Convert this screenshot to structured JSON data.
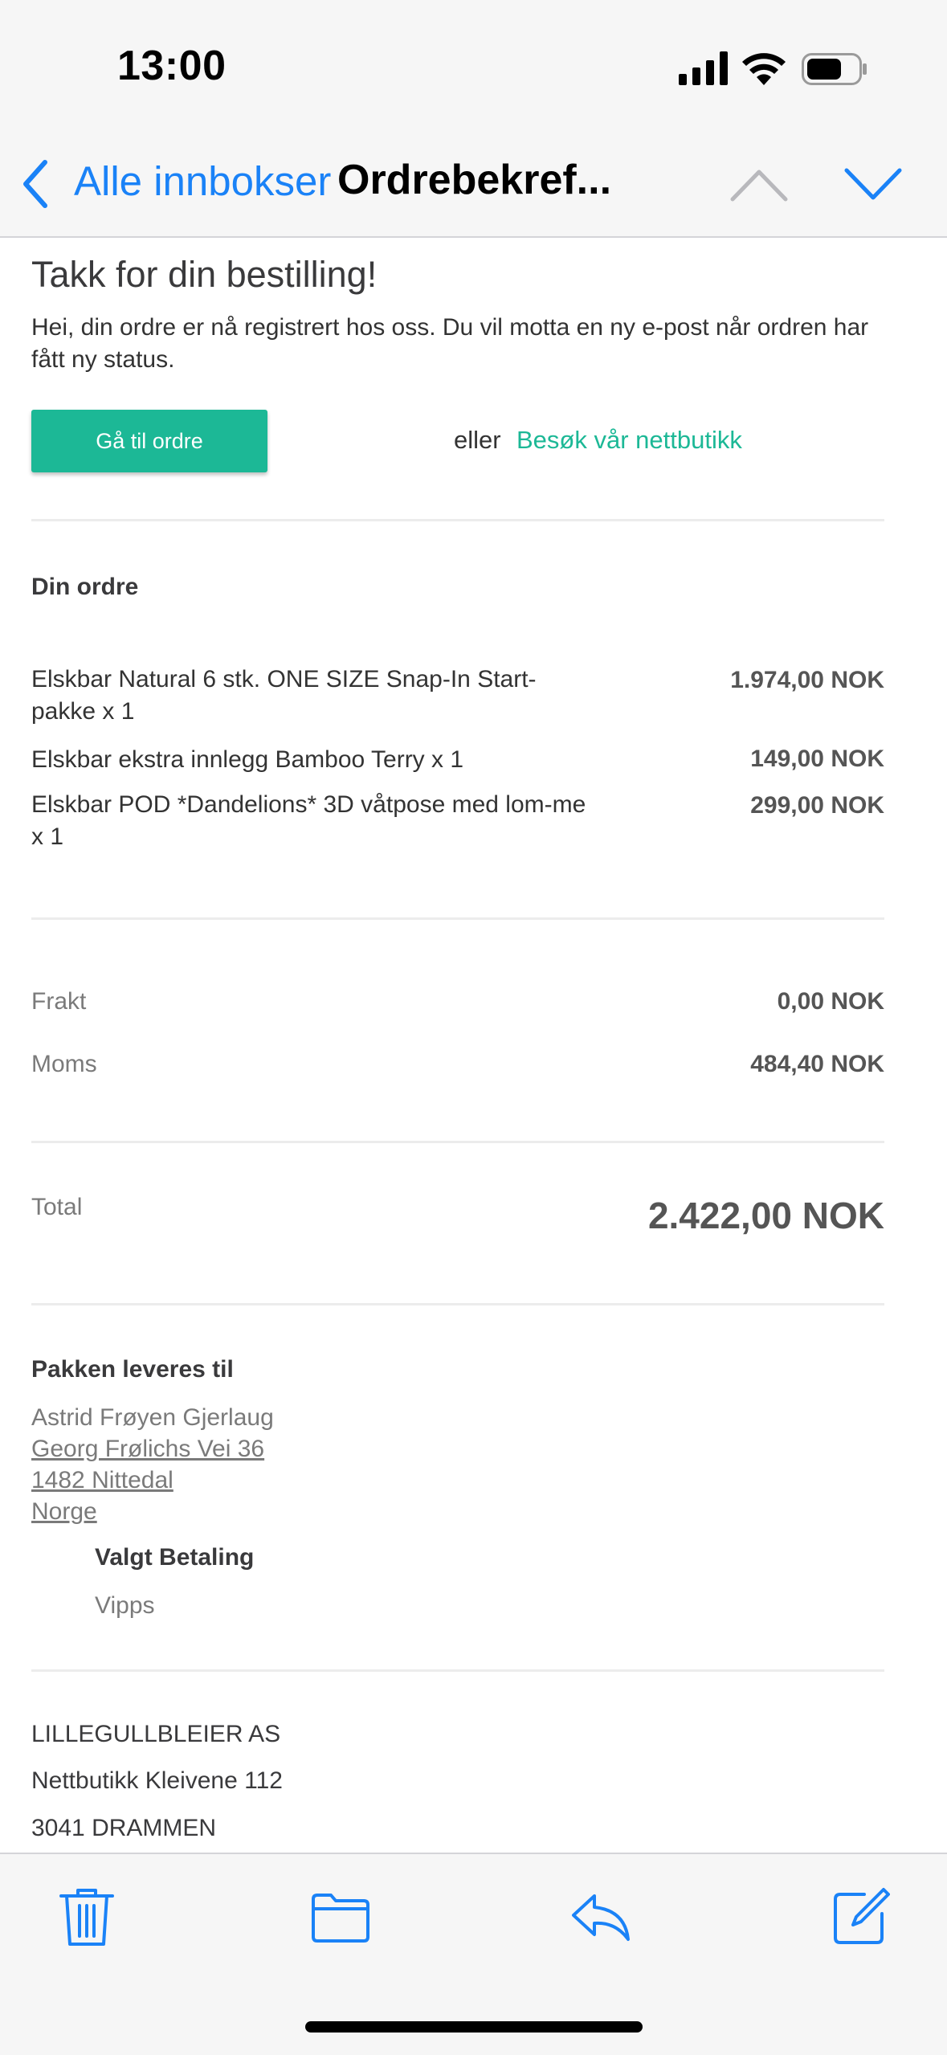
{
  "status": {
    "time": "13:00"
  },
  "nav": {
    "back_label": "Alle innbokser",
    "title": "Ordrebekref..."
  },
  "email": {
    "heading": "Takk for din bestilling!",
    "intro": "Hei, din ordre er nå registrert hos oss. Du vil motta en ny e-post når ordren har fått ny status.",
    "order_button": "Gå til ordre",
    "or_text": "eller",
    "shop_link": "Besøk vår nettbutikk",
    "order_title": "Din ordre",
    "items": [
      {
        "name": "Elskbar Natural 6 stk. ONE SIZE Snap-In Start-pakke  x  1",
        "price": "1.974,00 NOK"
      },
      {
        "name": "Elskbar ekstra innlegg Bamboo Terry  x  1",
        "price": "149,00 NOK"
      },
      {
        "name": "Elskbar POD *Dandelions* 3D våtpose med lom-me  x  1",
        "price": "299,00 NOK"
      }
    ],
    "shipping_label": "Frakt",
    "shipping_value": "0,00 NOK",
    "vat_label": "Moms",
    "vat_value": "484,40 NOK",
    "total_label": "Total",
    "total_value": "2.422,00 NOK",
    "delivery_title": "Pakken leveres til",
    "delivery_name": "Astrid Frøyen Gjerlaug",
    "delivery_street": "Georg Frølichs Vei 36",
    "delivery_city": "1482 Nittedal",
    "delivery_country": "Norge",
    "payment_title": "Valgt Betaling",
    "payment_method": "Vipps",
    "company_name": "LILLEGULLBLEIER AS",
    "company_address": "Nettbutikk Kleivene 112",
    "company_city": "3041 DRAMMEN"
  },
  "toolbar": {
    "icons": [
      "trash-icon",
      "folder-icon",
      "reply-icon",
      "compose-icon"
    ]
  },
  "colors": {
    "accent_blue": "#1a82f7",
    "button_green": "#1cb896"
  }
}
